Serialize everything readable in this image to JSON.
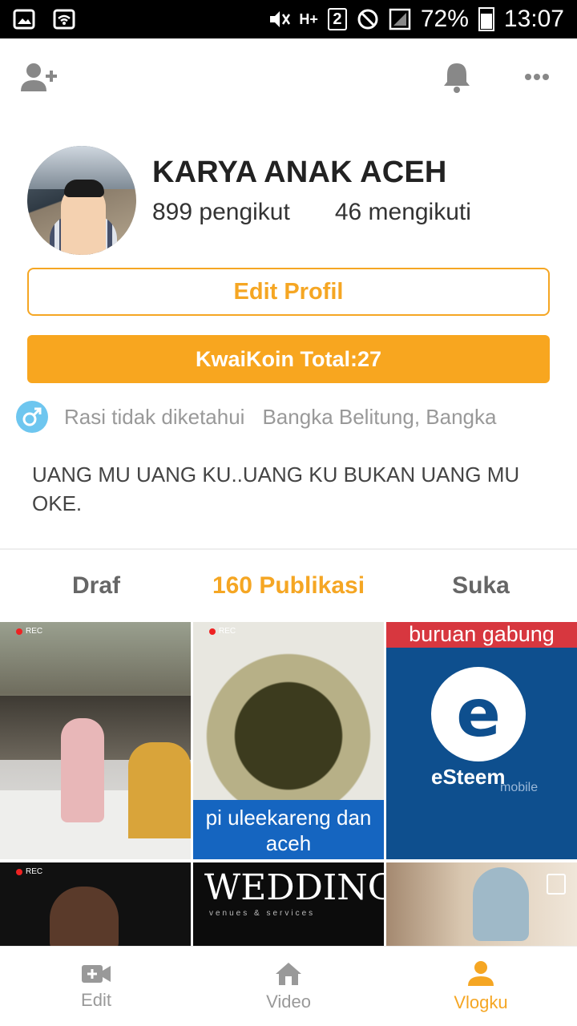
{
  "status_bar": {
    "network": "H+",
    "sim": "2",
    "battery": "72%",
    "time": "13:07"
  },
  "profile": {
    "name": "KARYA ANAK ACEH",
    "followers": "899 pengikut",
    "following": "46 mengikuti",
    "edit_label": "Edit Profil",
    "koin_label": "KwaiKoin Total:27",
    "zodiac": "Rasi tidak diketahui",
    "location": "Bangka Belitung, Bangka",
    "bio": "UANG MU UANG KU..UANG KU BUKAN UANG MU OKE."
  },
  "tabs": [
    {
      "label": "Draf"
    },
    {
      "label": "160 Publikasi"
    },
    {
      "label": "Suka"
    }
  ],
  "grid": {
    "t2_caption": "pi uleekareng dan aceh",
    "t3_banner": "buruan gabung",
    "t3_brand": "eSteem",
    "t3_sub": "mobile",
    "t5_title": "WEDDING",
    "t5_sub": "venues & services",
    "rec": "REC"
  },
  "bottom_nav": [
    {
      "label": "Edit"
    },
    {
      "label": "Video"
    },
    {
      "label": "Vlogku"
    }
  ],
  "colors": {
    "accent": "#f5a623",
    "gender": "#6ec6ef"
  }
}
